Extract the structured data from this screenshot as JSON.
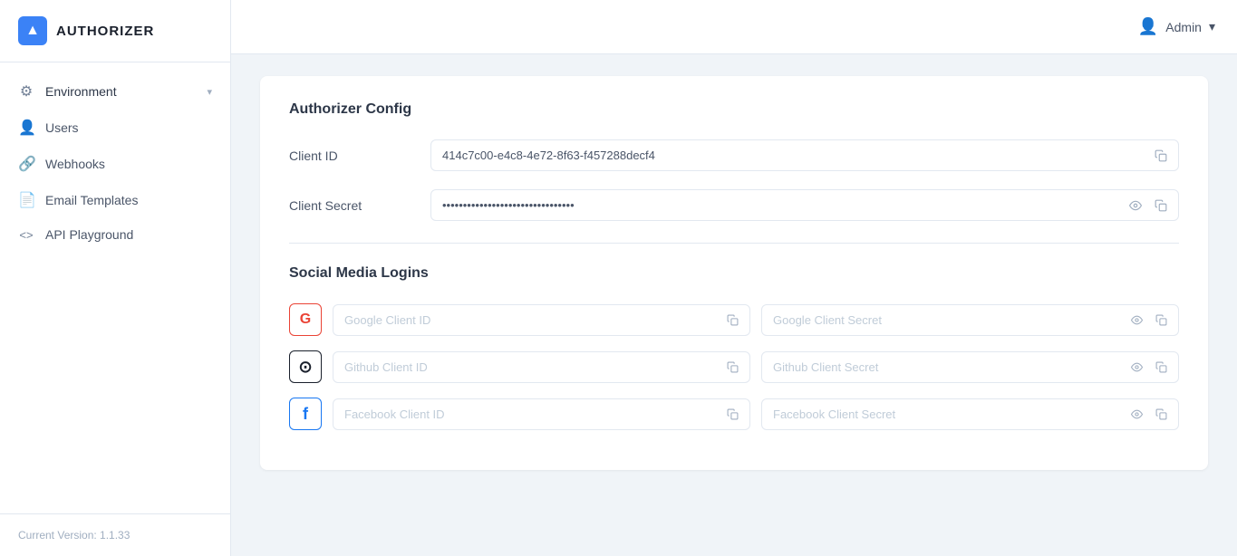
{
  "sidebar": {
    "logo_text": "AUTHORIZER",
    "logo_icon": "▲",
    "nav_items": [
      {
        "id": "environment",
        "label": "Environment",
        "icon": "⚙",
        "has_chevron": true
      },
      {
        "id": "users",
        "label": "Users",
        "icon": "👤"
      },
      {
        "id": "webhooks",
        "label": "Webhooks",
        "icon": "🔗"
      },
      {
        "id": "email-templates",
        "label": "Email Templates",
        "icon": "📄"
      },
      {
        "id": "api-playground",
        "label": "API Playground",
        "icon": "<>"
      }
    ],
    "version_label": "Current Version: 1.1.33"
  },
  "header": {
    "user_label": "Admin",
    "chevron": "▾"
  },
  "authorizer_config": {
    "section_title": "Authorizer Config",
    "client_id_label": "Client ID",
    "client_id_value": "414c7c00-e4c8-4e72-8f63-f457288decf4",
    "client_secret_label": "Client Secret",
    "client_secret_value": "••••••••••••••••••••••••••••••••"
  },
  "social_media": {
    "section_title": "Social Media Logins",
    "providers": [
      {
        "id": "google",
        "icon_label": "G",
        "icon_class": "google",
        "client_id_placeholder": "Google Client ID",
        "client_secret_placeholder": "Google Client Secret"
      },
      {
        "id": "github",
        "icon_label": "⊙",
        "icon_class": "github",
        "client_id_placeholder": "Github Client ID",
        "client_secret_placeholder": "Github Client Secret"
      },
      {
        "id": "facebook",
        "icon_label": "f",
        "icon_class": "facebook",
        "client_id_placeholder": "Facebook Client ID",
        "client_secret_placeholder": "Facebook Client Secret"
      }
    ]
  }
}
